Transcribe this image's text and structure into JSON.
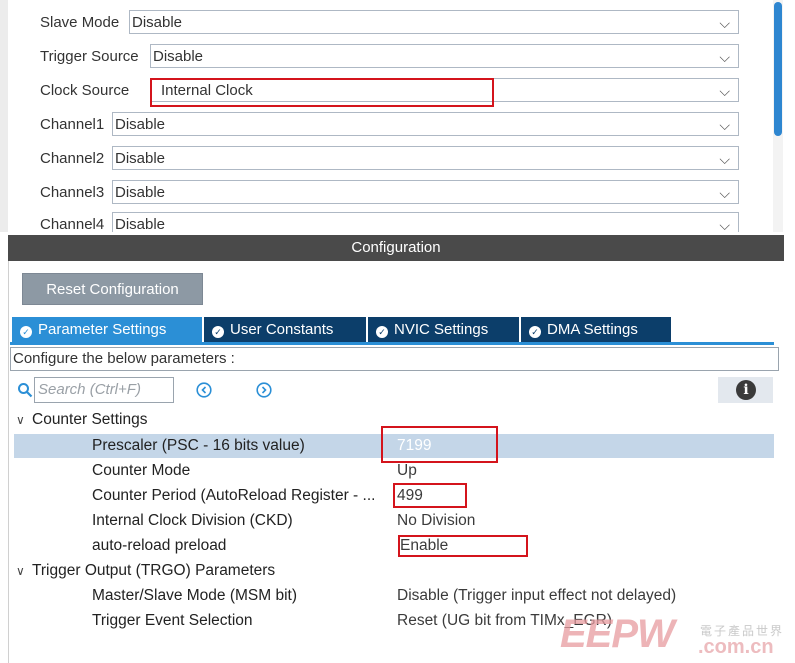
{
  "mode_fields": [
    {
      "label": "Slave Mode",
      "value": "Disable"
    },
    {
      "label": "Trigger Source",
      "value": "Disable"
    },
    {
      "label": "Clock Source",
      "value": "Internal Clock"
    },
    {
      "label": "Channel1",
      "value": "Disable"
    },
    {
      "label": "Channel2",
      "value": "Disable"
    },
    {
      "label": "Channel3",
      "value": "Disable"
    },
    {
      "label": "Channel4",
      "value": "Disable"
    }
  ],
  "config": {
    "title": "Configuration",
    "reset_label": "Reset Configuration",
    "tabs": [
      "Parameter Settings",
      "User Constants",
      "NVIC Settings",
      "DMA Settings"
    ],
    "active_tab": "Parameter Settings",
    "description": "Configure the below parameters :",
    "search_placeholder": "Search (Ctrl+F)"
  },
  "groups": [
    {
      "title": "Counter Settings",
      "params": [
        {
          "name": "Prescaler (PSC - 16 bits value)",
          "value": "7199"
        },
        {
          "name": "Counter Mode",
          "value": "Up"
        },
        {
          "name": "Counter Period (AutoReload Register - ...",
          "value": "499"
        },
        {
          "name": "Internal Clock Division (CKD)",
          "value": "No Division"
        },
        {
          "name": "auto-reload preload",
          "value": "Enable"
        }
      ]
    },
    {
      "title": "Trigger Output (TRGO) Parameters",
      "params": [
        {
          "name": "Master/Slave Mode (MSM bit)",
          "value": "Disable (Trigger input effect not delayed)"
        },
        {
          "name": "Trigger Event Selection",
          "value": "Reset (UG bit from TIMx_EGR)"
        }
      ]
    }
  ],
  "watermark": {
    "brand": "EEPW",
    "cn": "電子產品世界",
    "domain": ".com.cn"
  },
  "colors": {
    "accent": "#2b8fd6",
    "tab_dark": "#0c3e6a",
    "highlight_box": "#d4141c",
    "selected_row": "#c4d6e8"
  },
  "icons": {
    "select_chevron": "chevron-down-icon",
    "tab_check": "check-circle-icon",
    "search": "search-icon",
    "prev": "arrow-left-circle-icon",
    "next": "arrow-right-circle-icon",
    "info": "info-icon"
  }
}
